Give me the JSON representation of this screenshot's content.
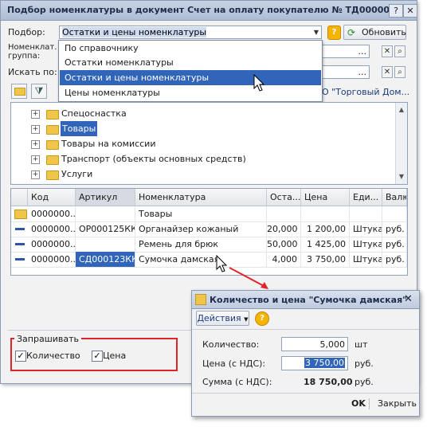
{
  "main_window": {
    "title": "Подбор номенклатуры в документ Счет на оплату покупателю № ТД0000000...",
    "help_btn": "?",
    "close_btn": "✕"
  },
  "filters": {
    "podbor_label": "Подбор:",
    "podbor_value": "Остатки и цены номенклатуры",
    "refresh_label": "Обновить",
    "nomenkl_label_1": "Номенклат.",
    "nomenkl_label_2": "группа:",
    "search_label": "Искать по:",
    "org_text": "О \"Торговый Дом..."
  },
  "dropdown": {
    "items": [
      "По справочнику",
      "Остатки номенклатуры",
      "Остатки и цены номенклатуры",
      "Цены номенклатуры"
    ],
    "selected_index": 2
  },
  "tree": {
    "items": [
      "Спецоснастка",
      "Товары",
      "Товары на комиссии",
      "Транспорт (объекты основных средств)",
      "Услуги"
    ],
    "selected_index": 1
  },
  "table": {
    "columns": [
      "Код",
      "Артикул",
      "Номенклатура",
      "Оста...",
      "Цена",
      "Еди...",
      "Валю"
    ],
    "rows": [
      {
        "icon": "folder",
        "code": "0000000...",
        "article": "",
        "name": "Товары",
        "rest": "",
        "price": "",
        "unit": "",
        "currency": ""
      },
      {
        "icon": "item",
        "code": "0000000...",
        "article": "ОР000125КК",
        "name": "Органайзер кожаный",
        "rest": "20,000",
        "price": "1 200,00",
        "unit": "Штука",
        "currency": "руб."
      },
      {
        "icon": "item",
        "code": "0000000...",
        "article": "",
        "name": "Ремень для брюк",
        "rest": "50,000",
        "price": "1 425,00",
        "unit": "Штука",
        "currency": "руб."
      },
      {
        "icon": "item",
        "code": "0000000...",
        "article": "СД000123КК",
        "name": "Сумочка дамская",
        "rest": "4,000",
        "price": "3 750,00",
        "unit": "Штука",
        "currency": "руб."
      }
    ]
  },
  "request_group": {
    "title": "Запрашивать",
    "qty_label": "Количество",
    "price_label": "Цена",
    "qty_checked": true,
    "price_checked": true
  },
  "dialog": {
    "title": "Количество и цена \"Сумочка дамская\"",
    "actions_label": "Действия",
    "help_btn": "?",
    "close_btn": "✕",
    "qty_label": "Количество:",
    "qty_value": "5,000",
    "qty_unit": "шт",
    "price_label": "Цена (с НДС):",
    "price_value": "3 750,00",
    "price_unit": "руб.",
    "sum_label": "Сумма (с НДС):",
    "sum_value": "18 750,00",
    "sum_unit": "руб.",
    "ok_label": "OK",
    "close_label": "Закрыть"
  },
  "colors": {
    "selection": "#3165b9",
    "highlight_border": "#e0242a",
    "arrow": "#e0242a"
  }
}
